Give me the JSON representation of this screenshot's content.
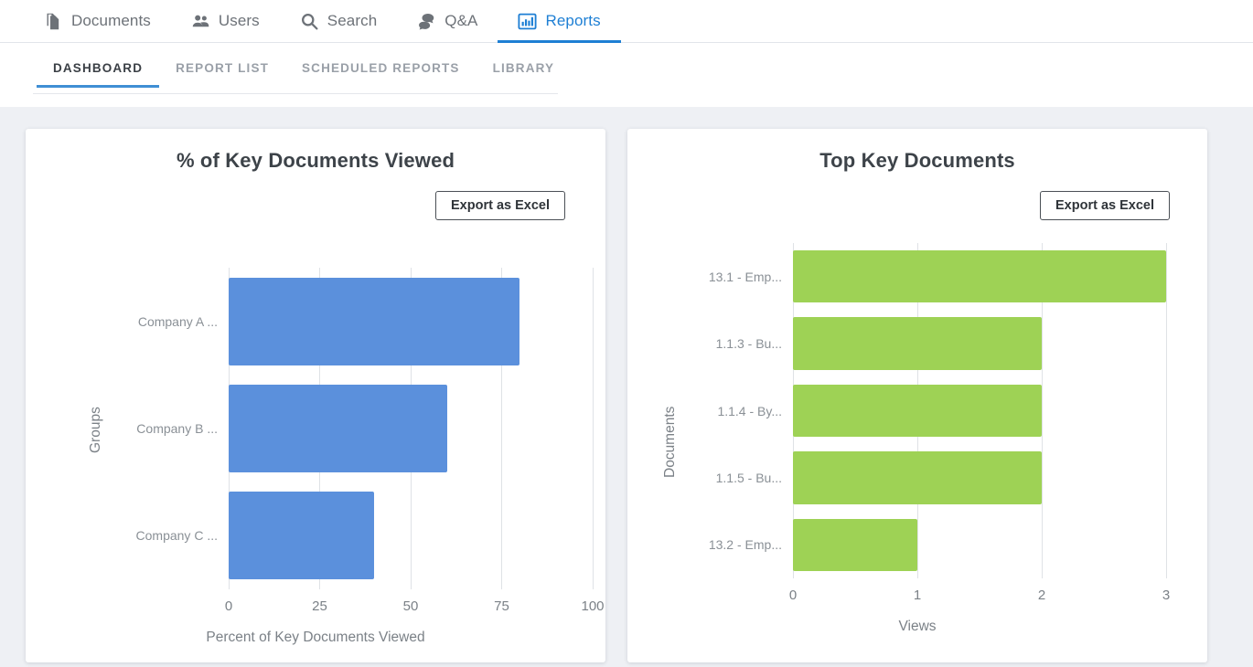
{
  "topnav": {
    "items": [
      {
        "label": "Documents",
        "icon": "documents-icon",
        "active": false
      },
      {
        "label": "Users",
        "icon": "users-icon",
        "active": false
      },
      {
        "label": "Search",
        "icon": "search-icon",
        "active": false
      },
      {
        "label": "Q&A",
        "icon": "qa-chat-icon",
        "active": false
      },
      {
        "label": "Reports",
        "icon": "bar-chart-icon",
        "active": true
      }
    ],
    "active_color": "#1e7fd4",
    "inactive_color": "#6d7278"
  },
  "subnav": {
    "tabs": [
      {
        "label": "DASHBOARD",
        "active": true
      },
      {
        "label": "REPORT LIST",
        "active": false
      },
      {
        "label": "SCHEDULED REPORTS",
        "active": false
      },
      {
        "label": "LIBRARY",
        "active": false
      }
    ],
    "active_color": "#3f8fd4"
  },
  "cards": [
    {
      "id": "left",
      "title": "% of Key Documents Viewed",
      "export_label": "Export as Excel"
    },
    {
      "id": "right",
      "title": "Top Key Documents",
      "export_label": "Export as Excel"
    }
  ],
  "chart_data": [
    {
      "type": "bar",
      "orientation": "horizontal",
      "title": "% of Key Documents Viewed",
      "categories": [
        "Company A ...",
        "Company B ...",
        "Company C ..."
      ],
      "values": [
        80,
        60,
        40
      ],
      "xlabel": "Percent of Key Documents Viewed",
      "ylabel": "Groups",
      "xlim": [
        0,
        100
      ],
      "xticks": [
        0,
        25,
        50,
        75,
        100
      ],
      "xtick_labels": [
        "0",
        "25",
        "50",
        "75",
        "100"
      ],
      "bar_color": "#5b90dc",
      "grid": true,
      "legend": "none"
    },
    {
      "type": "bar",
      "orientation": "horizontal",
      "title": "Top Key Documents",
      "categories": [
        "13.1 - Emp...",
        "1.1.3 - Bu...",
        "1.1.4 - By...",
        "1.1.5 - Bu...",
        "13.2 - Emp..."
      ],
      "values": [
        3,
        2,
        2,
        2,
        1
      ],
      "xlabel": "Views",
      "ylabel": "Documents",
      "xlim": [
        0,
        3
      ],
      "xticks": [
        0,
        1,
        2,
        3
      ],
      "xtick_labels": [
        "0",
        "1",
        "2",
        "3"
      ],
      "bar_color": "#9ed255",
      "grid": true,
      "legend": "none"
    }
  ]
}
